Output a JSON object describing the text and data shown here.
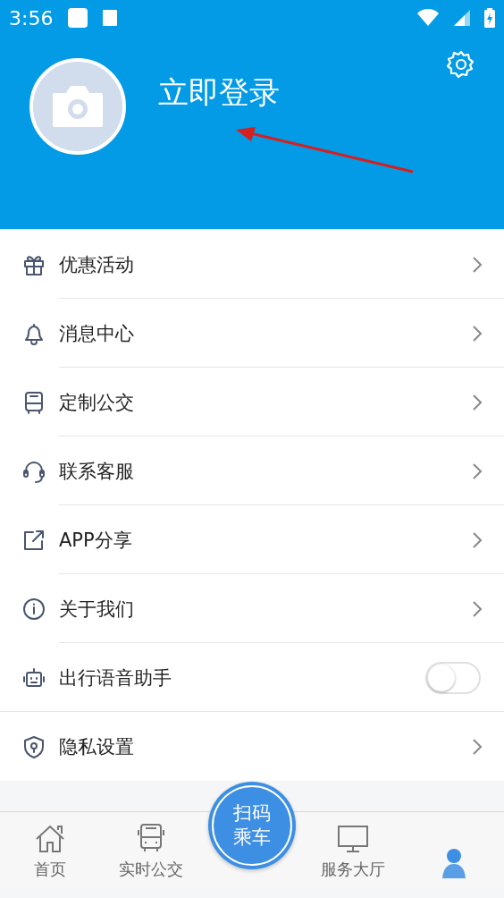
{
  "status_bar": {
    "time": "3:56"
  },
  "profile": {
    "login_label": "立即登录"
  },
  "menu": [
    {
      "kind": "link",
      "label": "优惠活动"
    },
    {
      "kind": "link",
      "label": "消息中心"
    },
    {
      "kind": "link",
      "label": "定制公交"
    },
    {
      "kind": "link",
      "label": "联系客服"
    },
    {
      "kind": "link",
      "label": "APP分享"
    },
    {
      "kind": "link",
      "label": "关于我们"
    },
    {
      "kind": "toggle",
      "label": "出行语音助手",
      "on": false
    },
    {
      "kind": "link",
      "label": "隐私设置"
    }
  ],
  "bottom_nav": [
    {
      "label": "首页",
      "selected": false
    },
    {
      "label": "实时公交",
      "selected": false
    },
    {
      "kind": "scan",
      "label": "扫码乘车",
      "selected": false
    },
    {
      "label": "服务大厅",
      "selected": false
    },
    {
      "selected": true
    }
  ]
}
